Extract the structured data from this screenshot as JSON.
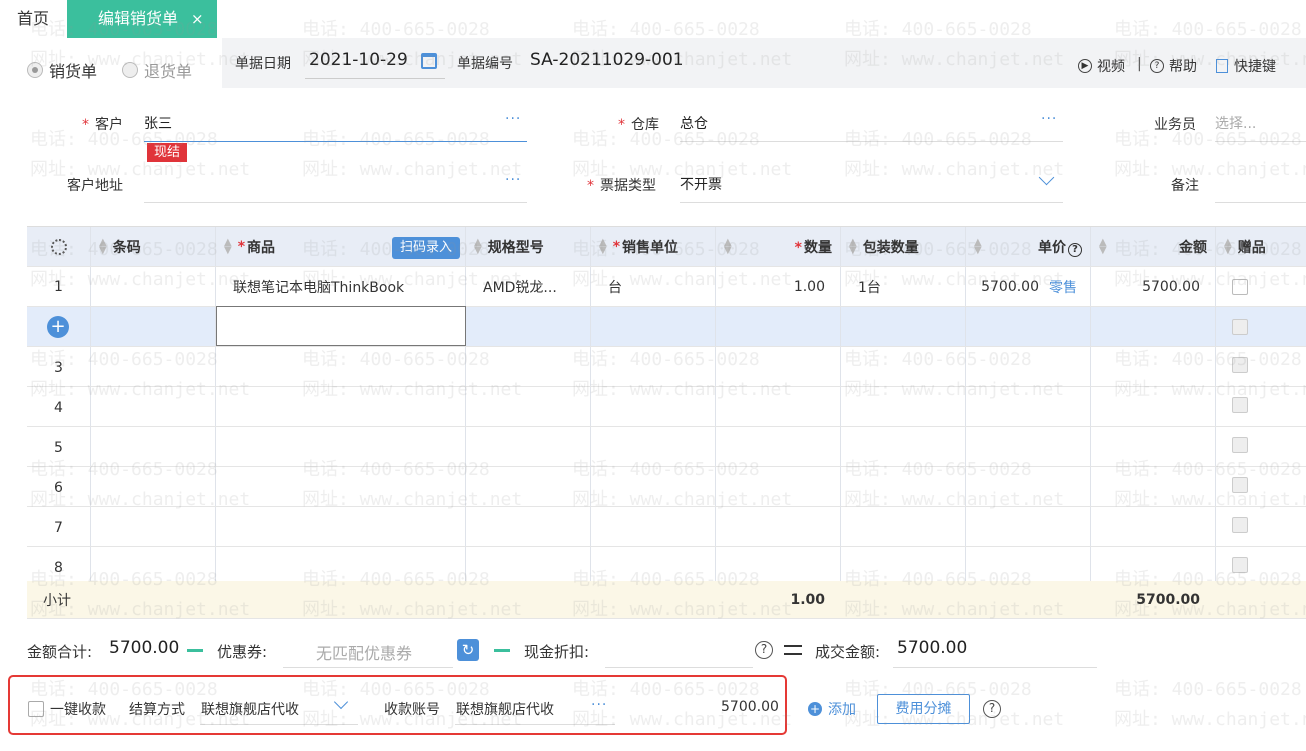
{
  "tabs": {
    "home": "首页",
    "active": "编辑销货单",
    "close": "×"
  },
  "header": {
    "radio_sale": "销货单",
    "radio_return": "退货单",
    "date_label": "单据日期",
    "date_value": "2021-10-29",
    "number_label": "单据编号",
    "number_value": "SA-20211029-001",
    "video": "视频",
    "separator": "|",
    "help": "帮助",
    "shortcut": "快捷键"
  },
  "form": {
    "required_mark": "*",
    "customer_label": "客户",
    "customer_value": "张三",
    "customer_badge": "现结",
    "warehouse_label": "仓库",
    "warehouse_value": "总仓",
    "salesman_label": "业务员",
    "salesman_placeholder": "选择...",
    "address_label": "客户地址",
    "invoice_label": "票据类型",
    "invoice_value": "不开票",
    "remark_label": "备注",
    "more": "···"
  },
  "table": {
    "headers": {
      "barcode": "条码",
      "product": "商品",
      "spec": "规格型号",
      "unit": "销售单位",
      "qty": "数量",
      "pack_qty": "包装数量",
      "price": "单价",
      "amount": "金额",
      "gift": "赠品"
    },
    "scan_button": "扫码录入",
    "price_help": "?",
    "row1": {
      "no": "1",
      "product": "联想笔记本电脑ThinkBook",
      "spec": "AMD锐龙...",
      "unit": "台",
      "qty": "1.00",
      "pack_qty": "1台",
      "price": "5700.00",
      "price_tag": "零售",
      "amount": "5700.00"
    },
    "add_icon": "+",
    "row_numbers": [
      "3",
      "4",
      "5",
      "6",
      "7",
      "8"
    ],
    "subtotal_label": "小计",
    "subtotal_qty": "1.00",
    "subtotal_amount": "5700.00"
  },
  "totals": {
    "sum_label": "金额合计:",
    "sum_value": "5700.00",
    "coupon_label": "优惠券:",
    "coupon_placeholder": "无匹配优惠券",
    "cash_discount_label": "现金折扣:",
    "deal_label": "成交金额:",
    "deal_value": "5700.00"
  },
  "payment": {
    "one_click": "一键收款",
    "settle_label": "结算方式",
    "settle_value": "联想旗舰店代收",
    "account_label": "收款账号",
    "account_value": "联想旗舰店代收",
    "amount": "5700.00",
    "add": "添加",
    "fee_button": "费用分摊"
  },
  "watermark": {
    "phone": "电话: 400-665-0028",
    "site": "网址: www.chanjet.net"
  },
  "colors": {
    "accent_green": "#3bbf9d",
    "accent_blue": "#4d90d9",
    "required_red": "#e0343a",
    "highlight_red": "#e53935"
  }
}
